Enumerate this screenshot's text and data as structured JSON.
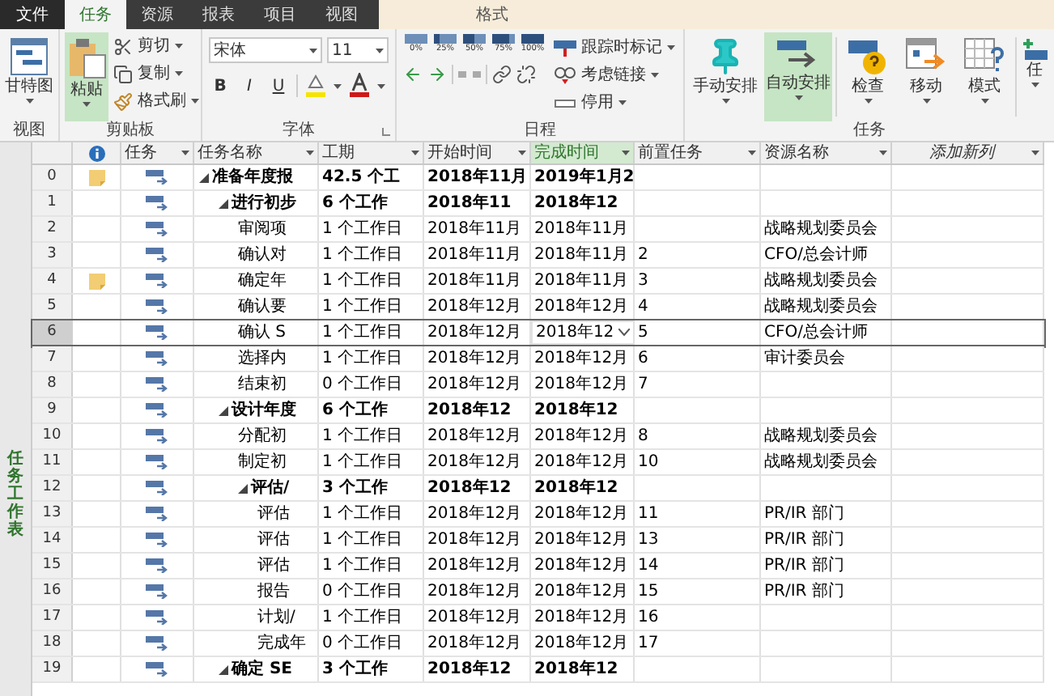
{
  "tabs": [
    {
      "label": "文件",
      "kind": "file",
      "selected": false
    },
    {
      "label": "任务",
      "kind": "normal",
      "selected": true
    },
    {
      "label": "资源",
      "kind": "normal",
      "selected": false
    },
    {
      "label": "报表",
      "kind": "normal",
      "selected": false
    },
    {
      "label": "项目",
      "kind": "normal",
      "selected": false
    },
    {
      "label": "视图",
      "kind": "normal",
      "selected": false
    },
    {
      "label": "格式",
      "kind": "contextual",
      "selected": false
    }
  ],
  "groups": [
    {
      "label": "视图",
      "items": [
        {
          "label": "甘特图",
          "selected": false
        }
      ]
    },
    {
      "label": "剪贴板",
      "items": [
        {
          "label": "粘贴",
          "selected": true
        },
        {
          "label": "剪切"
        },
        {
          "label": "复制"
        },
        {
          "label": "格式刷"
        }
      ]
    },
    {
      "label": "字体",
      "font": "宋体",
      "size": "11",
      "formats": [
        "B",
        "I",
        "U"
      ]
    },
    {
      "label": "日程",
      "percents": [
        "0%",
        "25%",
        "50%",
        "75%",
        "100%"
      ],
      "items": [
        {
          "label": "跟踪时标记"
        },
        {
          "label": "考虑链接"
        },
        {
          "label": "停用"
        }
      ]
    },
    {
      "label": "任务",
      "items": [
        {
          "label": "手动安排",
          "selected": false
        },
        {
          "label": "自动安排",
          "selected": true
        },
        {
          "label": "检查",
          "selected": false
        },
        {
          "label": "移动",
          "selected": false
        },
        {
          "label": "模式",
          "selected": false
        },
        {
          "label": "任",
          "selected": false
        }
      ]
    }
  ],
  "side_label": "任务工作表",
  "columns": [
    {
      "kind": "indicator",
      "selected": false
    },
    {
      "kind": "field",
      "label": "任务",
      "selected": false
    },
    {
      "kind": "field",
      "label": "任务名称",
      "selected": false
    },
    {
      "kind": "field",
      "label": "工期",
      "selected": false
    },
    {
      "kind": "field",
      "label": "开始时间",
      "selected": false
    },
    {
      "kind": "field",
      "label": "完成时间",
      "selected": true
    },
    {
      "kind": "field",
      "label": "前置任务",
      "selected": false
    },
    {
      "kind": "field",
      "label": "资源名称",
      "selected": false
    },
    {
      "kind": "add",
      "label": "添加新列",
      "selected": false
    }
  ],
  "rows": [
    {
      "id": "0",
      "name": "准备年度报",
      "duration": "42.5 个工",
      "start": "2018年11月",
      "finish": "2019年1月2",
      "note": true,
      "selected": false,
      "expanded": true,
      "children": [
        {
          "id": "1",
          "name": "进行初步",
          "duration": "6 个工作",
          "start": "2018年11",
          "finish": "2018年12",
          "note": false,
          "selected": false,
          "expanded": true,
          "children": [
            {
              "id": "2",
              "name": "审阅项",
              "duration": "1 个工作日",
              "start": "2018年11月",
              "finish": "2018年11月",
              "res": "战略规划委员会",
              "note": false,
              "selected": false
            },
            {
              "id": "3",
              "name": "确认对",
              "duration": "1 个工作日",
              "start": "2018年11月",
              "finish": "2018年11月",
              "pred": "2",
              "res": "CFO/总会计师",
              "note": false,
              "selected": false
            },
            {
              "id": "4",
              "name": "确定年",
              "duration": "1 个工作日",
              "start": "2018年11月",
              "finish": "2018年11月",
              "pred": "3",
              "res": "战略规划委员会",
              "note": true,
              "selected": false
            },
            {
              "id": "5",
              "name": "确认要",
              "duration": "1 个工作日",
              "start": "2018年12月",
              "finish": "2018年12月",
              "pred": "4",
              "res": "战略规划委员会",
              "note": false,
              "selected": false
            },
            {
              "id": "6",
              "name": "确认 S",
              "duration": "1 个工作日",
              "start": "2018年12月",
              "finish": "2018年12",
              "pred": "5",
              "res": "CFO/总会计师",
              "note": false,
              "selected": true
            },
            {
              "id": "7",
              "name": "选择内",
              "duration": "1 个工作日",
              "start": "2018年12月",
              "finish": "2018年12月",
              "pred": "6",
              "res": "审计委员会",
              "note": false,
              "selected": false
            },
            {
              "id": "8",
              "name": "结束初",
              "duration": "0 个工作日",
              "start": "2018年12月",
              "finish": "2018年12月",
              "pred": "7",
              "note": false,
              "selected": false
            }
          ]
        },
        {
          "id": "9",
          "name": "设计年度",
          "duration": "6 个工作",
          "start": "2018年12",
          "finish": "2018年12",
          "note": false,
          "selected": false,
          "expanded": true,
          "children": [
            {
              "id": "10",
              "name": "分配初",
              "duration": "1 个工作日",
              "start": "2018年12月",
              "finish": "2018年12月",
              "pred": "8",
              "res": "战略规划委员会",
              "note": false,
              "selected": false
            },
            {
              "id": "11",
              "name": "制定初",
              "duration": "1 个工作日",
              "start": "2018年12月",
              "finish": "2018年12月",
              "pred": "10",
              "res": "战略规划委员会",
              "note": false,
              "selected": false
            },
            {
              "id": "12",
              "name": "评估/",
              "duration": "3 个工作",
              "start": "2018年12",
              "finish": "2018年12",
              "note": false,
              "selected": false,
              "expanded": true,
              "children": [
                {
                  "id": "13",
                  "name": "评估",
                  "duration": "1 个工作日",
                  "start": "2018年12月",
                  "finish": "2018年12月",
                  "pred": "11",
                  "res": "PR/IR 部门",
                  "note": false,
                  "selected": false
                },
                {
                  "id": "14",
                  "name": "评估",
                  "duration": "1 个工作日",
                  "start": "2018年12月",
                  "finish": "2018年12月",
                  "pred": "13",
                  "res": "PR/IR 部门",
                  "note": false,
                  "selected": false
                },
                {
                  "id": "15",
                  "name": "评估",
                  "duration": "1 个工作日",
                  "start": "2018年12月",
                  "finish": "2018年12月",
                  "pred": "14",
                  "res": "PR/IR 部门",
                  "note": false,
                  "selected": false
                },
                {
                  "id": "16",
                  "name": "报告",
                  "duration": "0 个工作日",
                  "start": "2018年12月",
                  "finish": "2018年12月",
                  "pred": "15",
                  "res": "PR/IR 部门",
                  "note": false,
                  "selected": false
                },
                {
                  "id": "17",
                  "name": "计划/",
                  "duration": "1 个工作日",
                  "start": "2018年12月",
                  "finish": "2018年12月",
                  "pred": "16",
                  "note": false,
                  "selected": false
                },
                {
                  "id": "18",
                  "name": "完成年",
                  "duration": "0 个工作日",
                  "start": "2018年12月",
                  "finish": "2018年12月",
                  "pred": "17",
                  "note": false,
                  "selected": false
                }
              ]
            }
          ]
        },
        {
          "id": "19",
          "name": "确定 SE",
          "duration": "3 个工作",
          "start": "2018年12",
          "finish": "2018年12",
          "note": false,
          "selected": false,
          "expanded": true
        }
      ]
    }
  ]
}
